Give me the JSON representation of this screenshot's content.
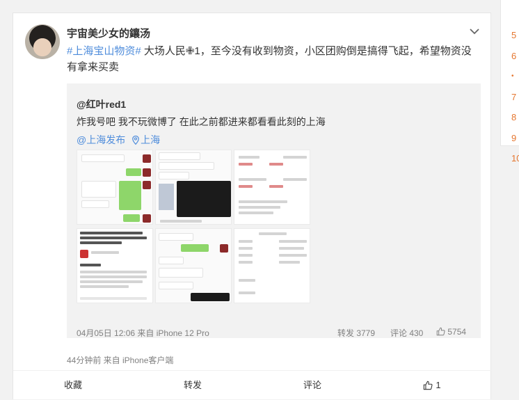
{
  "post": {
    "username": "宇宙美少女的鑲汤",
    "hashtag": "#上海宝山物资#",
    "body_text": " 大场人民✙1，至今没有收到物资，小区团购倒是搞得飞起，希望物资没有拿来买卖",
    "timestamp": "44分钟前  来自 iPhone客户端"
  },
  "repost": {
    "author": "@红叶red1",
    "text": "炸我号吧 我不玩微博了 在此之前都进来都看看此刻的上海",
    "mention": "@上海发布",
    "location": "上海",
    "images": [
      {
        "label": "chat-screenshot-1"
      },
      {
        "label": "chat-screenshot-2"
      },
      {
        "label": "document-screenshot-3"
      },
      {
        "label": "news-screenshot-4"
      },
      {
        "label": "chat-screenshot-5"
      },
      {
        "label": "document-screenshot-6"
      }
    ],
    "footer": {
      "time_source": "04月05日 12:06 来自 iPhone 12 Pro",
      "reposts": "转发 3779",
      "comments": "评论 430",
      "likes": "5754"
    }
  },
  "actions": {
    "favorite": "收藏",
    "repost": "转发",
    "comment": "评论",
    "like_count": "1"
  },
  "sidebar": {
    "numbers": [
      "5",
      "6",
      "•",
      "7",
      "8",
      "9",
      "10"
    ]
  },
  "colors": {
    "link": "#4e8cdb",
    "sidebar_rank": "#e5762f"
  }
}
